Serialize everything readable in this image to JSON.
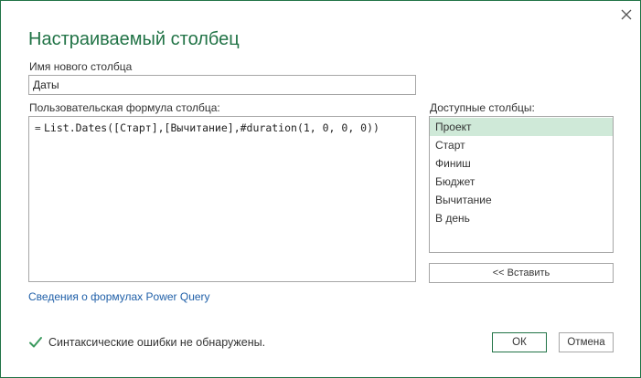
{
  "dialog": {
    "title": "Настраиваемый столбец",
    "close_icon": "close-icon"
  },
  "name": {
    "label": "Имя нового столбца",
    "value": "Даты"
  },
  "formula": {
    "label": "Пользовательская формула столбца:",
    "prefix": "=",
    "value": "List.Dates([Старт],[Вычитание],#duration(1, 0, 0, 0))"
  },
  "available": {
    "label": "Доступные столбцы:",
    "items": [
      "Проект",
      "Старт",
      "Финиш",
      "Бюджет",
      "Вычитание",
      "В день"
    ],
    "selected": "Проект"
  },
  "insert_button": "<< Вставить",
  "help_link": "Сведения о формулах Power Query",
  "status": {
    "icon": "checkmark-icon",
    "text": "Синтаксические ошибки не обнаружены."
  },
  "buttons": {
    "ok": "ОК",
    "cancel": "Отмена"
  },
  "colors": {
    "accent": "#217346",
    "selected_row": "#cfe9d8",
    "link": "#1f5fa8",
    "checkmark": "#3c9a5f"
  }
}
